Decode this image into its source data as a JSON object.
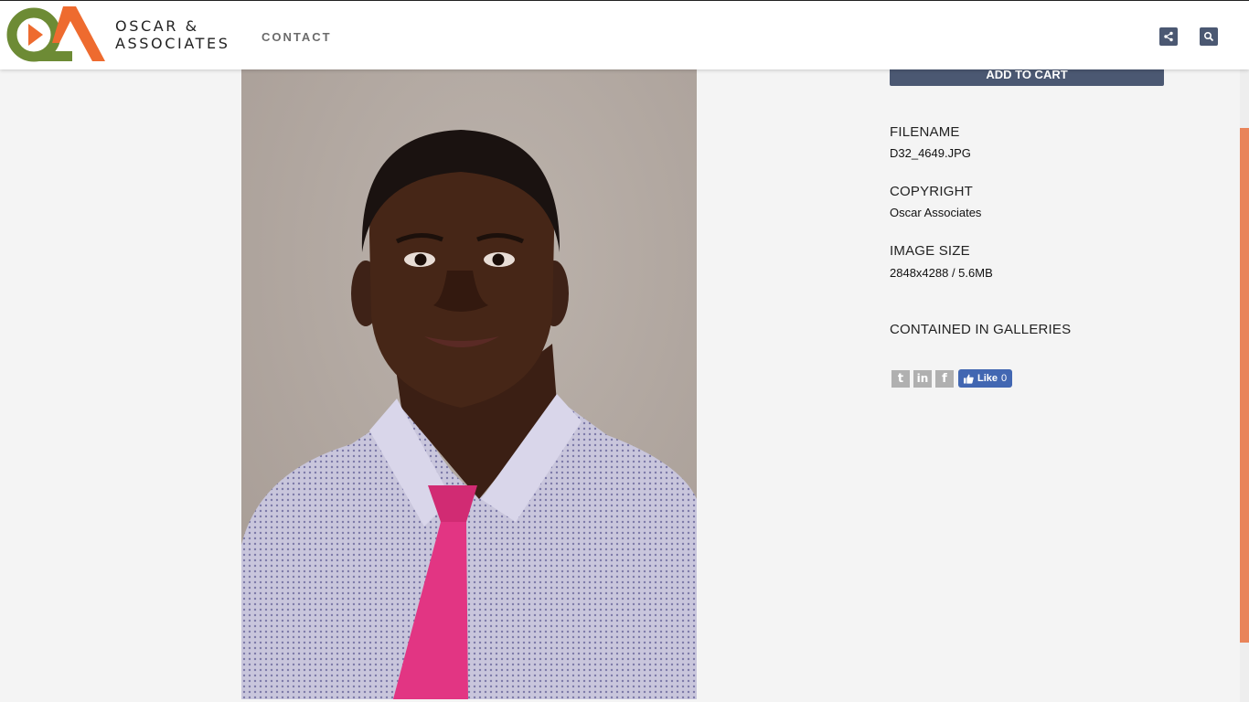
{
  "header": {
    "brand_line1": "OSCAR &",
    "brand_line2": "ASSOCIATES",
    "nav": {
      "contact": "CONTACT"
    },
    "icons": [
      "share-icon",
      "search-icon"
    ]
  },
  "colors": {
    "accent": "#4b5872",
    "logo_green": "#6d8b35",
    "logo_orange": "#ee6b2f",
    "scrollbar": "#e9845a",
    "facebook": "#4267b2"
  },
  "photo": {
    "alt": "D32_4649.JPG"
  },
  "sidebar": {
    "add_to_cart": "ADD TO CART",
    "filename_label": "FILENAME",
    "filename_value": "D32_4649.JPG",
    "copyright_label": "COPYRIGHT",
    "copyright_value": "Oscar Associates",
    "image_size_label": "IMAGE SIZE",
    "image_size_value": "2848x4288 / 5.6MB",
    "galleries_label": "CONTAINED IN GALLERIES",
    "social": {
      "icons": [
        "twitter-icon",
        "linkedin-icon",
        "facebook-icon"
      ],
      "twitter_glyph": "t",
      "linkedin_glyph": "in",
      "facebook_glyph": "f",
      "like_label": "Like",
      "like_count": "0"
    }
  }
}
